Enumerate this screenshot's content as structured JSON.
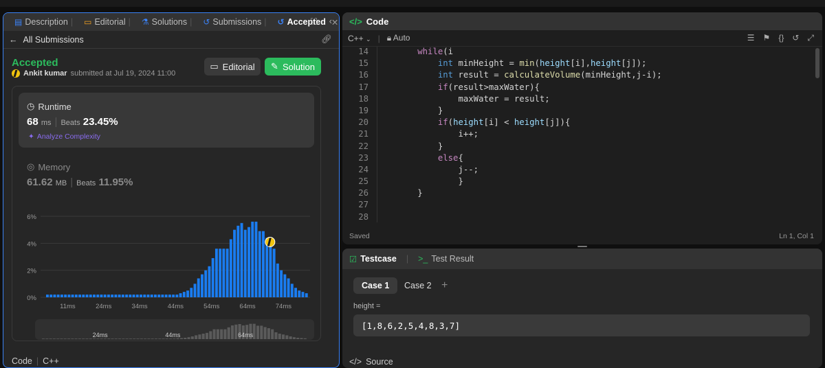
{
  "left_panel": {
    "tabs": [
      {
        "label": "Description",
        "icon": "document-icon"
      },
      {
        "label": "Editorial",
        "icon": "book-icon"
      },
      {
        "label": "Solutions",
        "icon": "flask-icon"
      },
      {
        "label": "Submissions",
        "icon": "history-icon"
      },
      {
        "label": "Accepted",
        "icon": "history-icon"
      }
    ],
    "back_label": "All Submissions",
    "status": "Accepted",
    "submitter_name": "Ankit kumar",
    "submitted_text": "submitted at Jul 19, 2024 11:00",
    "editorial_button": "Editorial",
    "solution_button": "Solution",
    "runtime": {
      "label": "Runtime",
      "value": "68",
      "unit": "ms",
      "beats_label": "Beats",
      "beats_value": "23.45%",
      "analyze_label": "Analyze Complexity"
    },
    "memory": {
      "label": "Memory",
      "value": "61.62",
      "unit": "MB",
      "beats_label": "Beats",
      "beats_value": "11.95%"
    },
    "bottom_labels": {
      "code": "Code",
      "lang": "C++"
    }
  },
  "chart_data": {
    "type": "bar",
    "ylabel": "",
    "xlabel": "",
    "y_ticks": [
      "0%",
      "2%",
      "4%",
      "6%"
    ],
    "ylim": [
      0,
      6
    ],
    "x_ticks": [
      "11ms",
      "24ms",
      "34ms",
      "44ms",
      "54ms",
      "64ms",
      "74ms"
    ],
    "values": [
      0.2,
      0.2,
      0.2,
      0.2,
      0.2,
      0.2,
      0.2,
      0.2,
      0.2,
      0.2,
      0.2,
      0.2,
      0.2,
      0.2,
      0.2,
      0.2,
      0.2,
      0.2,
      0.2,
      0.2,
      0.2,
      0.2,
      0.2,
      0.2,
      0.2,
      0.2,
      0.2,
      0.2,
      0.2,
      0.2,
      0.2,
      0.2,
      0.2,
      0.2,
      0.2,
      0.2,
      0.2,
      0.3,
      0.4,
      0.5,
      0.7,
      1.0,
      1.4,
      1.7,
      2.0,
      2.3,
      2.9,
      3.6,
      3.6,
      3.6,
      3.6,
      4.3,
      5.0,
      5.3,
      5.5,
      5.0,
      5.2,
      5.6,
      5.6,
      4.9,
      4.9,
      4.4,
      4.0,
      3.6,
      2.5,
      2.0,
      1.7,
      1.4,
      1.0,
      0.7,
      0.5,
      0.4,
      0.3
    ],
    "highlight_index": 61,
    "mini_ticks": [
      "24ms",
      "44ms",
      "64ms"
    ]
  },
  "code_panel": {
    "title": "Code",
    "language": "C++",
    "mode": "Auto",
    "lines": [
      {
        "n": "14",
        "html": "        <span class=\"kw\">while</span>(i<j){"
      },
      {
        "n": "15",
        "html": "            <span class=\"ty\">int</span> minHeight = <span class=\"fn\">min</span>(<span class=\"id\">height</span>[i],<span class=\"id\">height</span>[j]);"
      },
      {
        "n": "16",
        "html": "            <span class=\"ty\">int</span> result = <span class=\"fn\">calculateVolume</span>(minHeight,j-i);"
      },
      {
        "n": "17",
        "html": "            <span class=\"kw\">if</span>(result>maxWater){"
      },
      {
        "n": "18",
        "html": "                maxWater = result;"
      },
      {
        "n": "19",
        "html": "            }"
      },
      {
        "n": "20",
        "html": "            <span class=\"kw\">if</span>(<span class=\"id\">height</span>[i] < <span class=\"id\">height</span>[j]){"
      },
      {
        "n": "21",
        "html": "                i++;"
      },
      {
        "n": "22",
        "html": "            }"
      },
      {
        "n": "23",
        "html": "            <span class=\"kw\">else</span>{"
      },
      {
        "n": "24",
        "html": "                j--;"
      },
      {
        "n": "25",
        "html": "                }"
      },
      {
        "n": "26",
        "html": "        }"
      },
      {
        "n": "27",
        "html": ""
      },
      {
        "n": "28",
        "html": ""
      }
    ],
    "saved": "Saved",
    "cursor": "Ln 1, Col 1"
  },
  "testcase_panel": {
    "tab_testcase": "Testcase",
    "tab_result": "Test Result",
    "case1": "Case 1",
    "case2": "Case 2",
    "add": "+",
    "param_label": "height =",
    "param_value": "[1,8,6,2,5,4,8,3,7]",
    "source": "Source"
  },
  "colors": {
    "accent_green": "#2cbb5d",
    "accent_blue": "#3b82f6",
    "bar_blue": "#1a7cf0"
  }
}
